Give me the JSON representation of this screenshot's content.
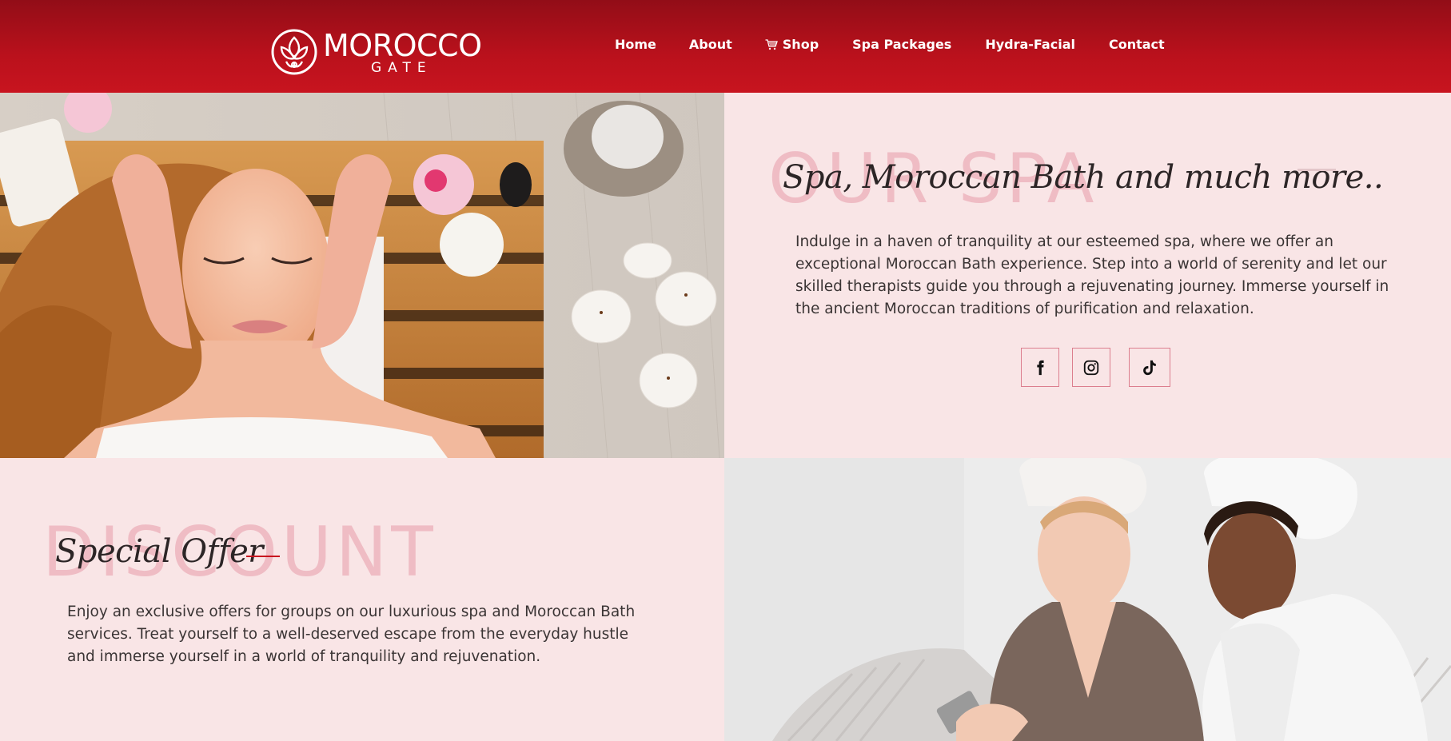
{
  "brand": {
    "name": "MOROCCO",
    "sub": "GATE"
  },
  "nav": {
    "home": "Home",
    "about": "About",
    "shop": "Shop",
    "spa_packages": "Spa Packages",
    "hydra_facial": "Hydra-Facial",
    "contact": "Contact"
  },
  "spa": {
    "ghost": "OUR SPA",
    "title": "Spa, Moroccan Bath and much more..",
    "text": "Indulge in a haven of tranquility at our esteemed spa, where we offer an exceptional Moroccan Bath experience. Step into a world of serenity and let our skilled therapists guide you through a rejuvenating journey. Immerse yourself in the ancient Moroccan traditions of purification and relaxation.",
    "socials": [
      "facebook-icon",
      "instagram-icon",
      "tiktok-icon"
    ]
  },
  "offer": {
    "ghost": "DISCOUNT",
    "title": "Special Offer",
    "text": "Enjoy an exclusive offers for groups on our luxurious spa and Moroccan Bath services. Treat yourself to a well-deserved escape from the everyday hustle and immerse yourself in a world of tranquility and rejuvenation."
  },
  "colors": {
    "header": "#ba111c",
    "panel": "#f9e5e6",
    "ghost": "#efbcc4",
    "accent": "#c8141f"
  }
}
